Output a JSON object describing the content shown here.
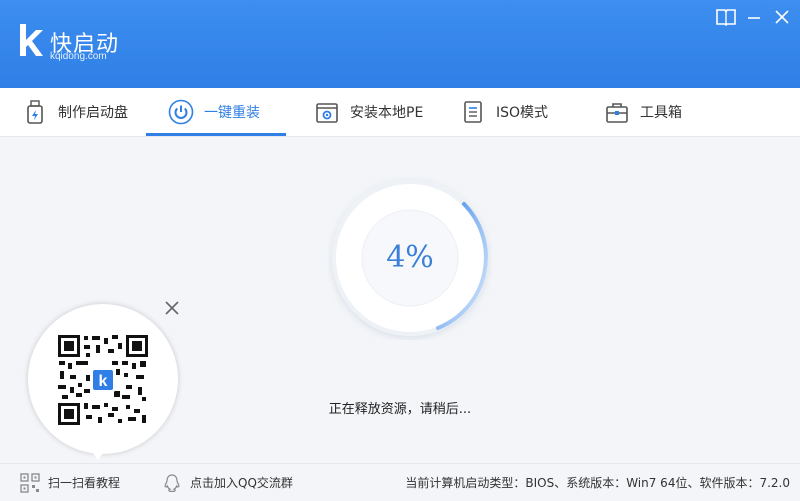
{
  "header": {
    "brand_name": "快启动",
    "brand_domain": "kqidong.com",
    "brand_color": "#2f7fe6"
  },
  "tabs": [
    {
      "label": "制作启动盘",
      "icon": "usb-drive-icon",
      "active": false
    },
    {
      "label": "一键重装",
      "icon": "power-icon",
      "active": true
    },
    {
      "label": "安装本地PE",
      "icon": "gear-box-icon",
      "active": false
    },
    {
      "label": "ISO模式",
      "icon": "document-list-icon",
      "active": false
    },
    {
      "label": "工具箱",
      "icon": "toolbox-icon",
      "active": false
    }
  ],
  "progress": {
    "percent_label": "4%",
    "fraction": 0.04,
    "status_text": "正在释放资源，请稍后..."
  },
  "qr_popup": {
    "center_mark": "k"
  },
  "footer": {
    "scan_label": "扫一扫看教程",
    "qq_label": "点击加入QQ交流群",
    "system_info": "当前计算机启动类型：BIOS、系统版本：Win7 64位、软件版本：7.2.0"
  }
}
